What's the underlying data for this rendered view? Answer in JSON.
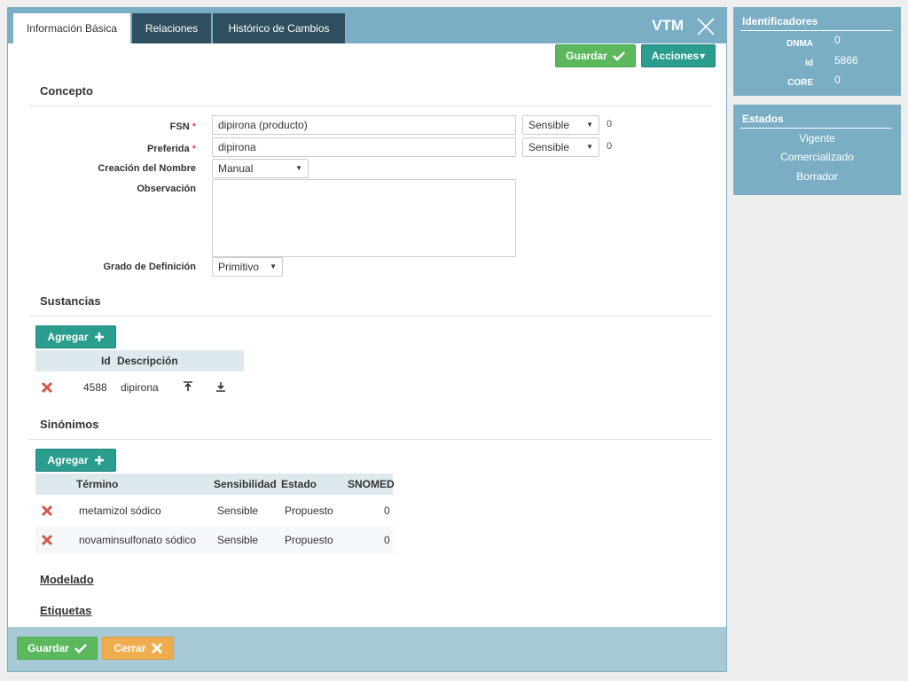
{
  "tabs": [
    {
      "label": "Información Básica",
      "active": true
    },
    {
      "label": "Relaciones",
      "active": false
    },
    {
      "label": "Histórico de Cambios",
      "active": false
    }
  ],
  "header": {
    "title": "VTM"
  },
  "toolbar": {
    "save_label": "Guardar",
    "actions_label": "Acciones"
  },
  "concepto": {
    "title": "Concepto",
    "fsn": {
      "label": "FSN",
      "value": "dipirona (producto)",
      "sensitivity": "Sensible",
      "count": "0"
    },
    "preferida": {
      "label": "Preferida",
      "value": "dipirona",
      "sensitivity": "Sensible",
      "count": "0"
    },
    "creacion": {
      "label": "Creación del Nombre",
      "value": "Manual"
    },
    "observacion": {
      "label": "Observación",
      "value": ""
    },
    "grado": {
      "label": "Grado de Definición",
      "value": "Primitivo"
    }
  },
  "sustancias": {
    "title": "Sustancias",
    "add_label": "Agregar",
    "headers": {
      "id": "Id",
      "descripcion": "Descripción"
    },
    "rows": [
      {
        "id": "4588",
        "descripcion": "dipirona"
      }
    ]
  },
  "sinonimos": {
    "title": "Sinónimos",
    "add_label": "Agregar",
    "headers": {
      "termino": "Término",
      "sensibilidad": "Sensibilidad",
      "estado": "Estado",
      "snomed": "SNOMED"
    },
    "rows": [
      {
        "termino": "metamizol sódico",
        "sensibilidad": "Sensible",
        "estado": "Propuesto",
        "snomed": "0"
      },
      {
        "termino": "novaminsulfonato sódico",
        "sensibilidad": "Sensible",
        "estado": "Propuesto",
        "snomed": "0"
      }
    ]
  },
  "modelado": {
    "title": "Modelado"
  },
  "etiquetas": {
    "title": "Etiquetas"
  },
  "footer": {
    "save_label": "Guardar",
    "close_label": "Cerrar"
  },
  "identificadores": {
    "title": "Identificadores",
    "items": [
      {
        "key": "DNMA",
        "value": "0"
      },
      {
        "key": "Id",
        "value": "5866"
      },
      {
        "key": "CORE",
        "value": "0"
      }
    ]
  },
  "estados": {
    "title": "Estados",
    "items": [
      "Vigente",
      "Comercializado",
      "Borrador"
    ]
  },
  "colors": {
    "header_bg": "#7aaec4",
    "tab_dark": "#2f4f5e",
    "success": "#5cb85c",
    "teal": "#2a9d8f",
    "warning": "#f0ad4e",
    "danger": "#d9534f",
    "footer_bg": "#a7c9d6"
  }
}
